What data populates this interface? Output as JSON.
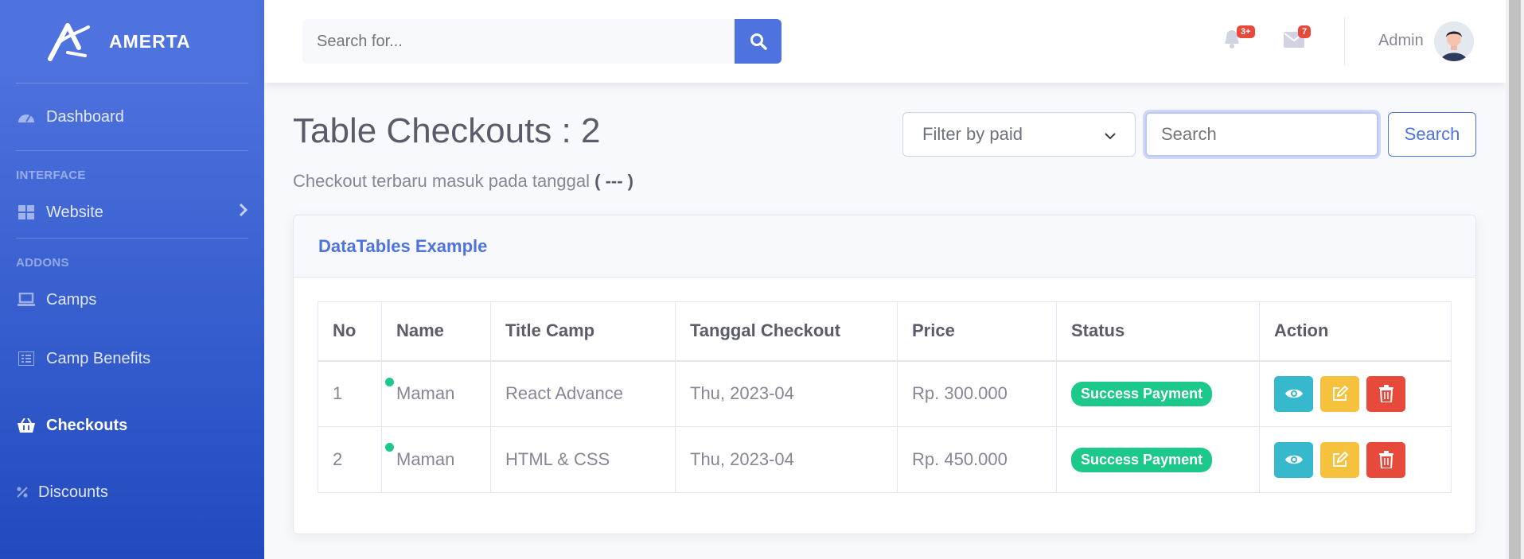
{
  "brand": {
    "name": "AMERTA"
  },
  "sidebar": {
    "items_top": [
      {
        "label": "Dashboard",
        "icon": "tachometer-icon"
      }
    ],
    "heading_interface": "INTERFACE",
    "items_interface": [
      {
        "label": "Website",
        "icon": "grid-icon"
      }
    ],
    "heading_addons": "ADDONS",
    "items_addons": [
      {
        "label": "Camps",
        "icon": "laptop-icon"
      },
      {
        "label": "Camp Benefits",
        "icon": "list-icon"
      },
      {
        "label": "Checkouts",
        "icon": "basket-icon",
        "active": true
      },
      {
        "label": "Discounts",
        "icon": "percent-icon"
      }
    ]
  },
  "topbar": {
    "search_placeholder": "Search for...",
    "alerts_badge": "3+",
    "messages_badge": "7",
    "user_name": "Admin"
  },
  "main": {
    "title": "Table Checkouts : 2",
    "subtitle_prefix": "Checkout terbaru masuk pada tanggal",
    "subtitle_value": "( --- )",
    "filter_select": "Filter by paid",
    "search_placeholder": "Search",
    "search_button": "Search",
    "card_title": "DataTables Example",
    "columns": [
      "No",
      "Name",
      "Title Camp",
      "Tanggal Checkout",
      "Price",
      "Status",
      "Action"
    ],
    "rows": [
      {
        "no": "1",
        "name": "Maman",
        "title": "React Advance",
        "date": "Thu, 2023-04",
        "price": "Rp. 300.000",
        "status": "Success Payment"
      },
      {
        "no": "2",
        "name": "Maman",
        "title": "HTML & CSS",
        "date": "Thu, 2023-04",
        "price": "Rp. 450.000",
        "status": "Success Payment"
      }
    ]
  },
  "colors": {
    "primary": "#4e73df",
    "success": "#1cc88a",
    "info": "#36b9cc",
    "warning": "#f6c23e",
    "danger": "#e74a3b"
  }
}
